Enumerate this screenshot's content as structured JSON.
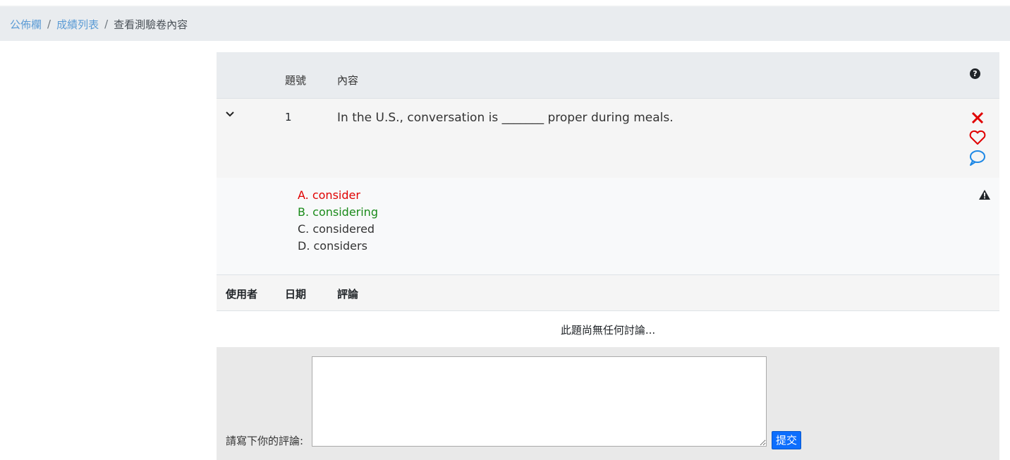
{
  "breadcrumb": {
    "items": [
      "公佈欄",
      "成績列表"
    ],
    "separator": "/",
    "current": "查看測驗卷內容"
  },
  "question_table": {
    "header_number": "題號",
    "header_content": "內容",
    "help_icon": "question-circle-icon",
    "question": {
      "number": "1",
      "text": "In the U.S., conversation is _______ proper during meals.",
      "actions": [
        "close-icon",
        "heart-icon",
        "chat-bubble-icon"
      ]
    },
    "options": {
      "a": "A. consider",
      "b": "B. considering",
      "c": "C. considered",
      "d": "D. considers"
    },
    "colors": {
      "wrong": "#e00000",
      "correct": "#1a8a1a",
      "link": "#5b9bd5"
    },
    "report_icon": "warning-icon"
  },
  "comments": {
    "header_user": "使用者",
    "header_date": "日期",
    "header_comment": "評論",
    "empty_message": "此題尚無任何討論..."
  },
  "comment_form": {
    "label": "請寫下你的評論:",
    "textarea_value": "",
    "submit_label": "提交"
  }
}
